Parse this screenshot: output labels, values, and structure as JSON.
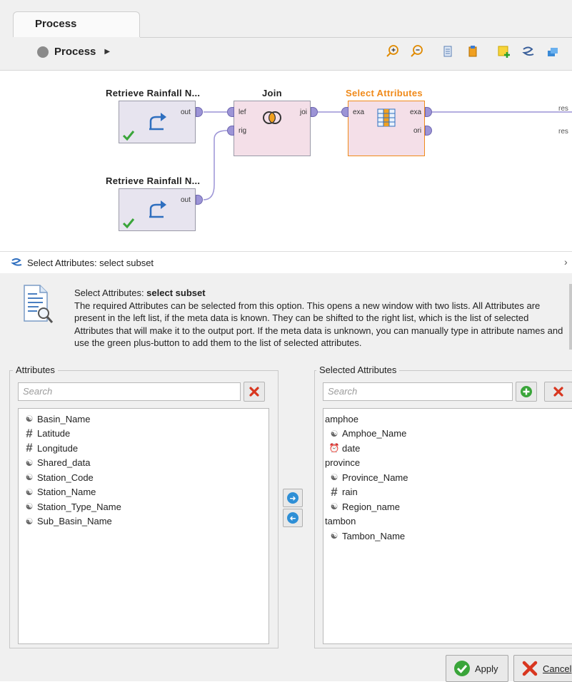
{
  "process_tab": {
    "label": "Process"
  },
  "breadcrumb": {
    "label": "Process"
  },
  "toolbar_icons": [
    "zoom-in-icon",
    "zoom-out-icon",
    "auto-arrange-icon",
    "order-icon",
    "add-note-icon",
    "connect-icon",
    "layers-icon"
  ],
  "operators": {
    "retrieve1": {
      "title": "Retrieve Rainfall N...",
      "out": "out"
    },
    "retrieve2": {
      "title": "Retrieve Rainfall N...",
      "out": "out"
    },
    "join": {
      "title": "Join",
      "in1": "lef",
      "in2": "rig",
      "out": "joi"
    },
    "select": {
      "title": "Select Attributes",
      "in": "exa",
      "out1": "exa",
      "out2": "ori"
    }
  },
  "result_ports": [
    "res",
    "res"
  ],
  "colors": {
    "select_title": "#f08a1a",
    "operator_fill": "#e7e4ef",
    "join_fill": "#f4dfe8",
    "connection": "#9c94d6"
  },
  "property_header": {
    "title": "Select Attributes: select subset"
  },
  "description": {
    "prefix": "Select Attributes: ",
    "title_bold": "select subset",
    "body": "The required Attributes can be selected from this option. This opens a new window with two lists. All Attributes are present in the left list, if the meta data is known. They can be shifted to the right list, which is the list of selected Attributes that will make it to the output port. If the meta data is unknown, you can manually type in attribute names and use the green plus-button to add them to the list of selected attributes."
  },
  "left_panel": {
    "legend": "Attributes",
    "search_placeholder": "Search",
    "items": [
      {
        "label": "Basin_Name",
        "type": "nominal"
      },
      {
        "label": "Latitude",
        "type": "numeric"
      },
      {
        "label": "Longitude",
        "type": "numeric"
      },
      {
        "label": "Shared_data",
        "type": "nominal"
      },
      {
        "label": "Station_Code",
        "type": "nominal"
      },
      {
        "label": "Station_Name",
        "type": "nominal"
      },
      {
        "label": "Station_Type_Name",
        "type": "nominal"
      },
      {
        "label": "Sub_Basin_Name",
        "type": "nominal"
      }
    ]
  },
  "right_panel": {
    "legend": "Selected Attributes",
    "search_placeholder": "Search",
    "items": [
      {
        "label": "amphoe",
        "type": "group"
      },
      {
        "label": "Amphoe_Name",
        "type": "nominal"
      },
      {
        "label": "date",
        "type": "date"
      },
      {
        "label": "province",
        "type": "group"
      },
      {
        "label": "Province_Name",
        "type": "nominal"
      },
      {
        "label": "rain",
        "type": "numeric"
      },
      {
        "label": "Region_name",
        "type": "nominal"
      },
      {
        "label": "tambon",
        "type": "group"
      },
      {
        "label": "Tambon_Name",
        "type": "nominal"
      }
    ]
  },
  "buttons": {
    "apply": "Apply",
    "cancel": "Cancel"
  }
}
